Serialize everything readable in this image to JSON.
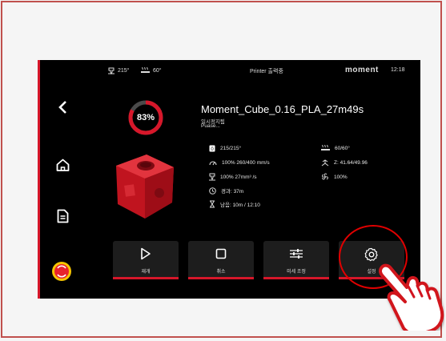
{
  "status_bar": {
    "nozzle_temp": "215°",
    "bed_temp": "60°",
    "printer_status": "Printer 출력중",
    "brand": "moment",
    "time": "12:18"
  },
  "print": {
    "progress_percent": 83,
    "progress_label": "83%",
    "file_name": "Moment_Cube_0.16_PLA_27m49s",
    "state_kr": "일시정지됨",
    "state_en": "Puase..."
  },
  "stats": {
    "nozzle": "215/215°",
    "bed": "60/60°",
    "speed": "100%  260/400 mm/s",
    "z_position": "Z: 41.64/49.96",
    "flow": "100%  27mm³ /s",
    "fan": "100%",
    "elapsed": "경과: 37m",
    "remaining": "남음: 10m / 12:10"
  },
  "controls": {
    "resume": "재개",
    "cancel": "취소",
    "fine_tune": "미세 조정",
    "settings": "설정"
  },
  "icons": [
    "back-icon",
    "home-icon",
    "document-icon",
    "emergency-stop-icon",
    "nozzle-icon",
    "heatbed-icon",
    "speed-icon",
    "z-axis-icon",
    "flow-icon",
    "fan-icon",
    "clock-icon",
    "hourglass-icon",
    "play-icon",
    "stop-icon",
    "sliders-icon",
    "gear-icon",
    "pointing-hand-icon"
  ],
  "colors": {
    "accent": "#d6172a",
    "highlight": "#e00000",
    "screen_bg": "#000000",
    "frame": "#c0504d"
  }
}
